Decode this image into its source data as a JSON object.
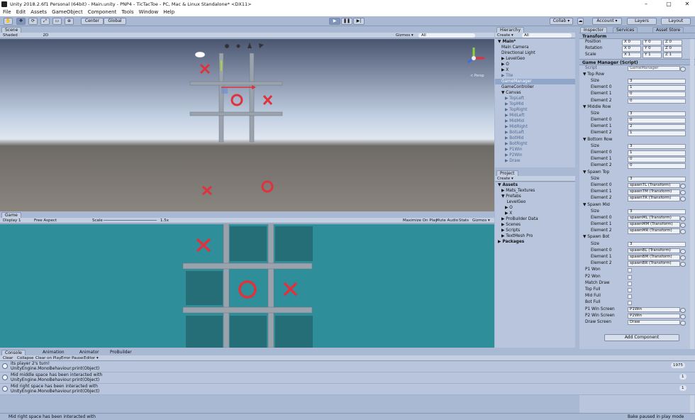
{
  "window": {
    "title": "Unity 2018.2.6f1 Personal (64bit) - Main.unity - PNP4 - TicTacToe - PC, Mac & Linux Standalone* <DX11>",
    "min": "–",
    "max": "▢",
    "close": "✕"
  },
  "menu": [
    "File",
    "Edit",
    "Assets",
    "GameObject",
    "Component",
    "Tools",
    "Window",
    "Help"
  ],
  "toolbar": {
    "center": "Center",
    "global": "Global",
    "collab": "Collab ▾",
    "account": "Account ▾",
    "layers": "Layers",
    "layout": "Layout"
  },
  "scene": {
    "tab": "Scene",
    "shading": "Shaded",
    "mode2d": "2D",
    "gizmos": "Gizmos ▾",
    "search": "All",
    "persp": "< Persp"
  },
  "game": {
    "tab": "Game",
    "display": "Display 1",
    "aspect": "Free Aspect",
    "scale": "Scale",
    "scale_val": "1.5x",
    "maximize": "Maximize On Play",
    "mute": "Mute Audio",
    "stats": "Stats",
    "gizmos": "Gizmos ▾"
  },
  "hierarchy": {
    "tab": "Hierarchy",
    "create": "Create ▾",
    "search": "All",
    "items": [
      {
        "t": "▼ Main*",
        "i": 0,
        "b": true
      },
      {
        "t": "Main Camera",
        "i": 2
      },
      {
        "t": "Directional Light",
        "i": 2
      },
      {
        "t": "▶ LevelGeo",
        "i": 2
      },
      {
        "t": "▶ O",
        "i": 2
      },
      {
        "t": "▶ X",
        "i": 2
      },
      {
        "t": "▶ Tile",
        "i": 2,
        "g": true
      },
      {
        "t": "GameManager",
        "i": 2,
        "s": true
      },
      {
        "t": "GameController",
        "i": 2
      },
      {
        "t": "▼ Canvas",
        "i": 2
      },
      {
        "t": "▶ TopLeft",
        "i": 4,
        "g": true
      },
      {
        "t": "▶ TopMid",
        "i": 4,
        "g": true
      },
      {
        "t": "▶ TopRight",
        "i": 4,
        "g": true
      },
      {
        "t": "▶ MidLeft",
        "i": 4,
        "g": true
      },
      {
        "t": "▶ MidMid",
        "i": 4,
        "g": true
      },
      {
        "t": "▶ MidRight",
        "i": 4,
        "g": true
      },
      {
        "t": "▶ BotLeft",
        "i": 4,
        "g": true
      },
      {
        "t": "▶ BotMid",
        "i": 4,
        "g": true
      },
      {
        "t": "▶ BotRight",
        "i": 4,
        "g": true
      },
      {
        "t": "▶ P1Win",
        "i": 4,
        "g": true
      },
      {
        "t": "▶ P2Win",
        "i": 4,
        "g": true
      },
      {
        "t": "▶ Draw",
        "i": 4,
        "g": true
      }
    ]
  },
  "project": {
    "tab": "Project",
    "create": "Create ▾",
    "items": [
      {
        "t": "▼ Assets",
        "i": 0,
        "b": true
      },
      {
        "t": "▶ Mats_Textures",
        "i": 2
      },
      {
        "t": "▼ Prefabs",
        "i": 2
      },
      {
        "t": "LevelGeo",
        "i": 5
      },
      {
        "t": "▶ O",
        "i": 4
      },
      {
        "t": "▶ X",
        "i": 4
      },
      {
        "t": "▶ ProBuilder Data",
        "i": 2
      },
      {
        "t": "▶ Scenes",
        "i": 2
      },
      {
        "t": "▶ Scripts",
        "i": 2
      },
      {
        "t": "▶ TextMesh Pro",
        "i": 2
      },
      {
        "t": "▶ Packages",
        "i": 0,
        "b": true
      }
    ]
  },
  "inspector": {
    "tab": "Inspector",
    "tab2": "Services",
    "tab3": "Asset Store",
    "transform": "Transform",
    "rows": [
      [
        "Position",
        "X 0",
        "Y 0",
        "Z 0"
      ],
      [
        "Rotation",
        "X 0",
        "Y 0",
        "Z 0"
      ],
      [
        "Scale",
        "X 1",
        "Y 1",
        "Z 1"
      ]
    ],
    "component": "Game Manager (Script)",
    "script_label": "Script",
    "script_val": "GameManager",
    "fields": [
      {
        "h": "▼ Top Row"
      },
      {
        "l": "Size",
        "v": "3"
      },
      {
        "l": "Element 0",
        "v": "1"
      },
      {
        "l": "Element 1",
        "v": "0"
      },
      {
        "l": "Element 2",
        "v": "0"
      },
      {
        "h": "▼ Middle Row"
      },
      {
        "l": "Size",
        "v": "3"
      },
      {
        "l": "Element 0",
        "v": "0"
      },
      {
        "l": "Element 1",
        "v": "2"
      },
      {
        "l": "Element 2",
        "v": "1"
      },
      {
        "h": "▼ Bottom Row"
      },
      {
        "l": "Size",
        "v": "3"
      },
      {
        "l": "Element 0",
        "v": "1"
      },
      {
        "l": "Element 1",
        "v": "0"
      },
      {
        "l": "Element 2",
        "v": "0"
      },
      {
        "h": "▼ Spawn Top"
      },
      {
        "l": "Size",
        "v": "3"
      },
      {
        "l": "Element 0",
        "v": "spawnTL (Transform)",
        "r": true
      },
      {
        "l": "Element 1",
        "v": "spawnTM (Transform)",
        "r": true
      },
      {
        "l": "Element 2",
        "v": "spawnTR (Transform)",
        "r": true
      },
      {
        "h": "▼ Spawn Mid"
      },
      {
        "l": "Size",
        "v": "3"
      },
      {
        "l": "Element 0",
        "v": "spawnML (Transform)",
        "r": true
      },
      {
        "l": "Element 1",
        "v": "spawnMM (Transform)",
        "r": true
      },
      {
        "l": "Element 2",
        "v": "spawnMR (Transform)",
        "r": true
      },
      {
        "h": "▼ Spawn Bot"
      },
      {
        "l": "Size",
        "v": "3"
      },
      {
        "l": "Element 0",
        "v": "spawnBL (Transform)",
        "r": true
      },
      {
        "l": "Element 1",
        "v": "spawnBM (Transform)",
        "r": true
      },
      {
        "l": "Element 2",
        "v": "spawnBR (Transform)",
        "r": true
      },
      {
        "l": "P1 Won",
        "c": true
      },
      {
        "l": "P2 Won",
        "c": true
      },
      {
        "l": "Match Draw",
        "c": true
      },
      {
        "l": "Top Full",
        "c": true
      },
      {
        "l": "Mid Full",
        "c": true
      },
      {
        "l": "Bot Full",
        "c": true
      },
      {
        "l": "P1 Win Screen",
        "v": "P1Win",
        "r": true
      },
      {
        "l": "P2 Win Screen",
        "v": "P2Win",
        "r": true
      },
      {
        "l": "Draw Screen",
        "v": "Draw",
        "r": true
      }
    ],
    "add_component": "Add Component"
  },
  "console": {
    "tabs": [
      "Console",
      "Animation",
      "Animator",
      "ProBuilder"
    ],
    "buttons": [
      "Clear",
      "Collapse",
      "Clear on Play",
      "Error Pause",
      "Editor ▾"
    ],
    "entries": [
      {
        "l1": "its player 2's turn!",
        "l2": "UnityEngine.MonoBehaviour:print(Object)",
        "n": "1975"
      },
      {
        "l1": "Mid middle space has been interacted with",
        "l2": "UnityEngine.MonoBehaviour:print(Object)",
        "n": "1"
      },
      {
        "l1": "Mid right space has been interacted with",
        "l2": "UnityEngine.MonoBehaviour:print(Object)",
        "n": "1"
      }
    ]
  },
  "status": {
    "message": "Mid right space has been interacted with",
    "right": "Bake paused in play mode"
  }
}
